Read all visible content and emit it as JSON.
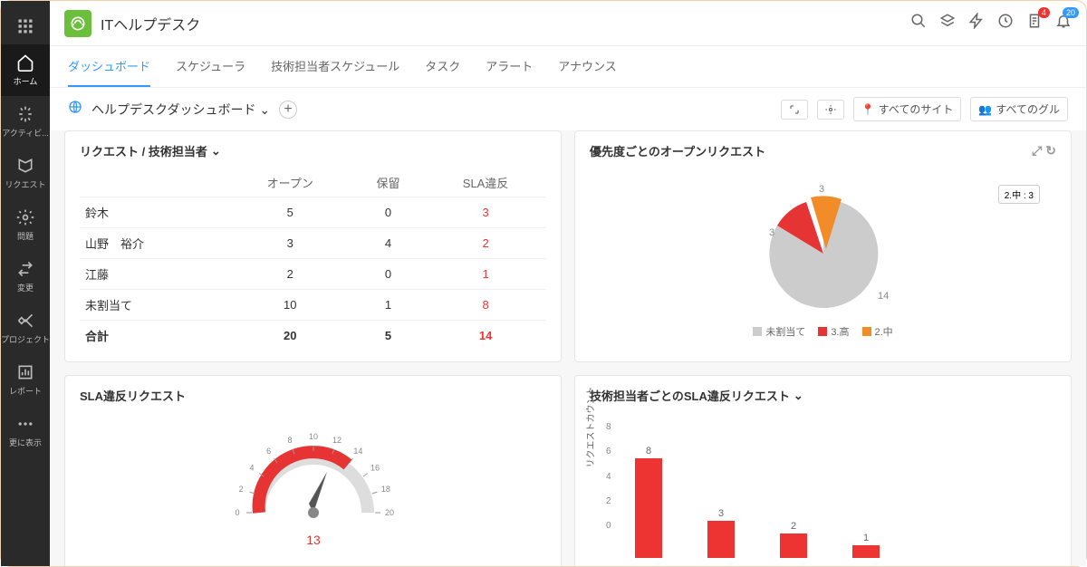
{
  "app": {
    "title": "ITヘルプデスク"
  },
  "badges": {
    "alert": "4",
    "bell": "20"
  },
  "sidebar": {
    "items": [
      {
        "label": "",
        "icon": "apps"
      },
      {
        "label": "ホーム",
        "icon": "home"
      },
      {
        "label": "アクティビ...",
        "icon": "activity"
      },
      {
        "label": "リクエスト",
        "icon": "request"
      },
      {
        "label": "問題",
        "icon": "problem"
      },
      {
        "label": "変更",
        "icon": "change"
      },
      {
        "label": "プロジェクト",
        "icon": "project"
      },
      {
        "label": "レポート",
        "icon": "report"
      },
      {
        "label": "更に表示",
        "icon": "more"
      }
    ]
  },
  "tabs": [
    "ダッシュボード",
    "スケジューラ",
    "技術担当者スケジュール",
    "タスク",
    "アラート",
    "アナウンス"
  ],
  "subhead": {
    "title": "ヘルプデスクダッシュボード",
    "sites": "すべてのサイト",
    "groups": "すべてのグル"
  },
  "widget1": {
    "title": "リクエスト / 技術担当者",
    "cols": [
      "",
      "オープン",
      "保留",
      "SLA違反"
    ],
    "rows": [
      {
        "n": "鈴木",
        "o": "5",
        "h": "0",
        "s": "3"
      },
      {
        "n": "山野　裕介",
        "o": "3",
        "h": "4",
        "s": "2"
      },
      {
        "n": "江藤",
        "o": "2",
        "h": "0",
        "s": "1"
      },
      {
        "n": "未割当て",
        "o": "10",
        "h": "1",
        "s": "8"
      }
    ],
    "total": {
      "n": "合計",
      "o": "20",
      "h": "5",
      "s": "14"
    }
  },
  "widget2": {
    "title": "優先度ごとのオープンリクエスト",
    "callout": "2.中 : 3",
    "labels": {
      "unassigned": "14",
      "high": "3",
      "mid": "3"
    },
    "legend": [
      {
        "color": "#cccccc",
        "label": "未割当て"
      },
      {
        "color": "#e63333",
        "label": "3.高"
      },
      {
        "color": "#f28c28",
        "label": "2.中"
      }
    ]
  },
  "widget3": {
    "title": "SLA違反リクエスト",
    "value": "13",
    "ticks": [
      "0",
      "2",
      "4",
      "6",
      "8",
      "10",
      "12",
      "14",
      "16",
      "18",
      "20"
    ]
  },
  "widget4": {
    "title": "技術担当者ごとのSLA違反リクエスト",
    "ylabel": "リクエストカウント",
    "yticks": [
      "8",
      "6",
      "4",
      "2",
      "0"
    ],
    "bars": [
      {
        "label": "8",
        "value": 8
      },
      {
        "label": "3",
        "value": 3
      },
      {
        "label": "2",
        "value": 2
      },
      {
        "label": "1",
        "value": 1
      }
    ]
  },
  "chart_data": [
    {
      "type": "pie",
      "title": "優先度ごとのオープンリクエスト",
      "series": [
        {
          "name": "未割当て",
          "value": 14,
          "color": "#cccccc"
        },
        {
          "name": "3.高",
          "value": 3,
          "color": "#e63333"
        },
        {
          "name": "2.中",
          "value": 3,
          "color": "#f28c28"
        }
      ]
    },
    {
      "type": "gauge",
      "title": "SLA違反リクエスト",
      "value": 13,
      "range": [
        0,
        20
      ]
    },
    {
      "type": "bar",
      "title": "技術担当者ごとのSLA違反リクエスト",
      "ylabel": "リクエストカウント",
      "ylim": [
        0,
        8
      ],
      "values": [
        8,
        3,
        2,
        1
      ]
    }
  ]
}
